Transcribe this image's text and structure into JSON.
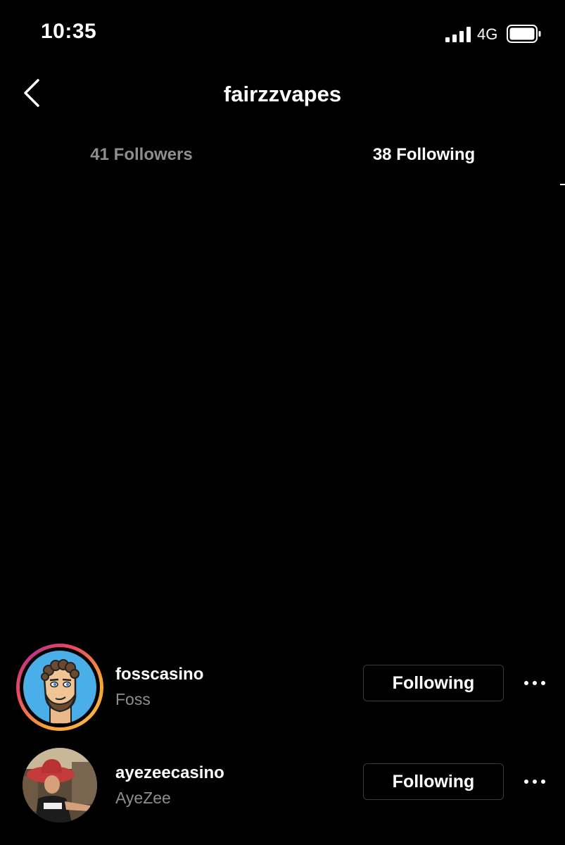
{
  "status_bar": {
    "time": "10:35",
    "network": "4G",
    "icons": [
      "signal-icon",
      "battery-icon"
    ]
  },
  "header": {
    "title": "fairzzvapes",
    "back_icon": "chevron-left-icon"
  },
  "tabs": [
    {
      "label": "41 Followers",
      "active": false
    },
    {
      "label": "38 Following",
      "active": true
    }
  ],
  "list": [
    {
      "username": "fosscasino",
      "full_name": "Foss",
      "button": "Following",
      "has_story_ring": true,
      "more_icon": "more-horizontal-icon"
    },
    {
      "username": "ayezeecasino",
      "full_name": "AyeZee",
      "button": "Following",
      "has_story_ring": false,
      "more_icon": "more-horizontal-icon"
    }
  ],
  "colors": {
    "background": "#000000",
    "text_primary": "#ffffff",
    "text_secondary": "#8e8e8e",
    "button_border": "#3a3a3a"
  }
}
